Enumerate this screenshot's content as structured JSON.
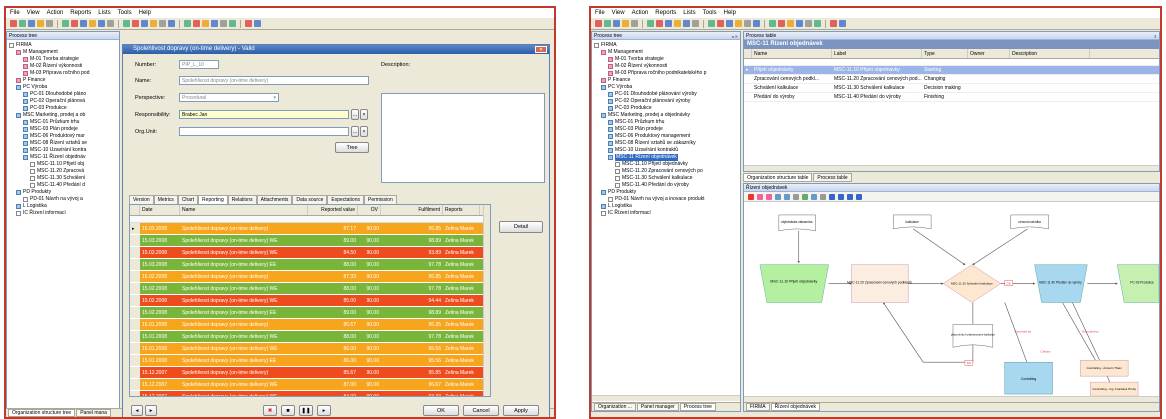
{
  "menu": [
    "File",
    "View",
    "Action",
    "Reports",
    "Lists",
    "Tools",
    "Help"
  ],
  "left": {
    "process_tree_title": "Process tree",
    "tree": [
      {
        "label": "FIRMA",
        "indent": 0,
        "icon": "white"
      },
      {
        "label": "M Management",
        "indent": 1,
        "icon": "pink"
      },
      {
        "label": "M-01 Tvorba strategie",
        "indent": 2,
        "icon": "pink"
      },
      {
        "label": "M-02 Řízení výkonnosti",
        "indent": 2,
        "icon": "pink"
      },
      {
        "label": "M-03 Příprava ročního pod",
        "indent": 2,
        "icon": "pink"
      },
      {
        "label": "P Finance",
        "indent": 1,
        "icon": "pink"
      },
      {
        "label": "PC Výroba",
        "indent": 1,
        "icon": "blue"
      },
      {
        "label": "PC-01 Dlouhodobé pláno",
        "indent": 2,
        "icon": "blue"
      },
      {
        "label": "PC-02 Operační plánová",
        "indent": 2,
        "icon": "blue"
      },
      {
        "label": "PC-03 Produkce",
        "indent": 2,
        "icon": "blue"
      },
      {
        "label": "MSC Marketing, prodej a ob",
        "indent": 1,
        "icon": "blue"
      },
      {
        "label": "MSC-01 Průzkum trhu",
        "indent": 2,
        "icon": "blue"
      },
      {
        "label": "MSC-03 Plán prodeje",
        "indent": 2,
        "icon": "blue"
      },
      {
        "label": "MSC-06 Produktový mar",
        "indent": 2,
        "icon": "blue"
      },
      {
        "label": "MSC-08 Řízení vztahů se",
        "indent": 2,
        "icon": "blue"
      },
      {
        "label": "MSC-10 Uzavírání kontra",
        "indent": 2,
        "icon": "blue"
      },
      {
        "label": "MSC-11 Řízení objednáv",
        "indent": 2,
        "icon": "blue"
      },
      {
        "label": "MSC-11.10 Přijetí obj",
        "indent": 3,
        "icon": "white"
      },
      {
        "label": "MSC-11.20 Zpracová",
        "indent": 3,
        "icon": "white"
      },
      {
        "label": "MSC-11.30 Schválení",
        "indent": 3,
        "icon": "white"
      },
      {
        "label": "MSC-11.40 Předání d",
        "indent": 3,
        "icon": "white"
      },
      {
        "label": "PD Produkty",
        "indent": 1,
        "icon": "blue"
      },
      {
        "label": "PD-01 Návrh na vývoj a",
        "indent": 2,
        "icon": "white"
      },
      {
        "label": "L Logistika",
        "indent": 1,
        "icon": "blue"
      },
      {
        "label": "IC Řízení informací",
        "indent": 1,
        "icon": "white"
      }
    ],
    "bottom_tabs": [
      "Organization structure tree",
      "Panel mana"
    ],
    "dialog": {
      "title": "Spolehlivost dopravy (on-time delivery) - Valid",
      "number_label": "Number:",
      "number_value": "PIP_L_10",
      "name_label": "Name:",
      "name_value": "Spolehlivost dopravy (on-time delivery)",
      "perspective_label": "Perspective:",
      "perspective_value": "Procedural",
      "responsibility_label": "Responsibility:",
      "responsibility_value": "Brabec Jan",
      "orgunit_label": "Org.Unit:",
      "description_label": "Description:",
      "tree_button": "Tree",
      "tabs": [
        "Version",
        "Metrics",
        "Chart",
        "Reporting",
        "Relations",
        "Attachments",
        "Data source",
        "Expectations",
        "Permission"
      ],
      "active_tab": "Reporting",
      "columns": [
        "Date",
        "Name",
        "Reported value",
        "OV",
        "Fulfilment",
        "Reports"
      ],
      "rows": [
        {
          "date": "15.03.2008",
          "name": "Spolehlivost dopravy (on-time delivery)",
          "value": "87.17",
          "ov": "90.00",
          "ful": "96.85",
          "rep": "Zelina Marek",
          "color": "#f7a51c"
        },
        {
          "date": "15.03.2008",
          "name": "Spolehlivost dopravy (on-time delivery) WE",
          "value": "89.00",
          "ov": "90.00",
          "ful": "98.89",
          "rep": "Zelina Marek",
          "color": "#7ab53b"
        },
        {
          "date": "15.03.2008",
          "name": "Spolehlivost dopravy (on-time delivery) WE",
          "value": "84.50",
          "ov": "90.00",
          "ful": "93.89",
          "rep": "Zelina Marek",
          "color": "#ee4b1e"
        },
        {
          "date": "15.03.2008",
          "name": "Spolehlivost dopravy (on-time delivery) EE",
          "value": "88.00",
          "ov": "90.00",
          "ful": "97.78",
          "rep": "Zelina Marek",
          "color": "#7ab53b"
        },
        {
          "date": "15.02.2008",
          "name": "Spolehlivost dopravy (on-time delivery)",
          "value": "87.33",
          "ov": "90.00",
          "ful": "96.85",
          "rep": "Zelina Marek",
          "color": "#f7a51c"
        },
        {
          "date": "15.02.2008",
          "name": "Spolehlivost dopravy (on-time delivery) WE",
          "value": "88.00",
          "ov": "90.00",
          "ful": "97.78",
          "rep": "Zelina Marek",
          "color": "#7ab53b"
        },
        {
          "date": "15.02.2008",
          "name": "Spolehlivost dopravy (on-time delivery) WE",
          "value": "85.00",
          "ov": "90.00",
          "ful": "94.44",
          "rep": "Zelina Marek",
          "color": "#ee4b1e"
        },
        {
          "date": "15.02.2008",
          "name": "Spolehlivost dopravy (on-time delivery) EE",
          "value": "89.00",
          "ov": "90.00",
          "ful": "98.89",
          "rep": "Zelina Marek",
          "color": "#7ab53b"
        },
        {
          "date": "15.01.2008",
          "name": "Spolehlivost dopravy (on-time delivery)",
          "value": "86.67",
          "ov": "90.00",
          "ful": "96.35",
          "rep": "Zelina Marek",
          "color": "#f7a51c"
        },
        {
          "date": "15.01.2008",
          "name": "Spolehlivost dopravy (on-time delivery) WE",
          "value": "88.00",
          "ov": "90.00",
          "ful": "97.78",
          "rep": "Zelina Marek",
          "color": "#7ab53b"
        },
        {
          "date": "15.01.2008",
          "name": "Spolehlivost dopravy (on-time delivery) WE",
          "value": "86.00",
          "ov": "90.00",
          "ful": "95.56",
          "rep": "Zelina Marek",
          "color": "#f7a51c"
        },
        {
          "date": "15.01.2008",
          "name": "Spolehlivost dopravy (on-time delivery) EE",
          "value": "86.00",
          "ov": "90.00",
          "ful": "95.56",
          "rep": "Zelina Marek",
          "color": "#f7a51c"
        },
        {
          "date": "15.12.2007",
          "name": "Spolehlivost dopravy (on-time delivery)",
          "value": "85.67",
          "ov": "90.00",
          "ful": "95.85",
          "rep": "Zelina Marek",
          "color": "#ee4b1e"
        },
        {
          "date": "15.12.2007",
          "name": "Spolehlivost dopravy (on-time delivery) WE",
          "value": "87.00",
          "ov": "90.00",
          "ful": "96.67",
          "rep": "Zelina Marek",
          "color": "#f7a51c"
        },
        {
          "date": "15.12.2007",
          "name": "Spolehlivost dopravy (on-time delivery) WE",
          "value": "84.00",
          "ov": "90.00",
          "ful": "93.33",
          "rep": "Zelina Marek",
          "color": "#ee4b1e"
        }
      ],
      "detail_button": "Detail",
      "ok_button": "OK",
      "cancel_button": "Cancel",
      "apply_button": "Apply"
    }
  },
  "right": {
    "process_tree_title": "Process tree",
    "tree": [
      {
        "label": "FIRMA",
        "indent": 0,
        "icon": "white"
      },
      {
        "label": "M Management",
        "indent": 1,
        "icon": "pink"
      },
      {
        "label": "M-01 Tvorba strategie",
        "indent": 2,
        "icon": "pink"
      },
      {
        "label": "M-02 Řízení výkonnosti",
        "indent": 2,
        "icon": "pink"
      },
      {
        "label": "M-03 Příprava ročního podnikatelského p",
        "indent": 2,
        "icon": "pink"
      },
      {
        "label": "P Finance",
        "indent": 1,
        "icon": "pink"
      },
      {
        "label": "PC Výroba",
        "indent": 1,
        "icon": "blue"
      },
      {
        "label": "PC-01 Dlouhodobé plánování výroby",
        "indent": 2,
        "icon": "blue"
      },
      {
        "label": "PC-02 Operační plánování výroby",
        "indent": 2,
        "icon": "blue"
      },
      {
        "label": "PC-03 Produkce",
        "indent": 2,
        "icon": "blue"
      },
      {
        "label": "MSC Marketing, prodej a objednávky",
        "indent": 1,
        "icon": "blue"
      },
      {
        "label": "MSC-01 Průzkum trhu",
        "indent": 2,
        "icon": "blue"
      },
      {
        "label": "MSC-03 Plán prodeje",
        "indent": 2,
        "icon": "blue"
      },
      {
        "label": "MSC-06 Produktový management",
        "indent": 2,
        "icon": "blue"
      },
      {
        "label": "MSC-08 Řízení vztahů se zákazníky",
        "indent": 2,
        "icon": "blue"
      },
      {
        "label": "MSC-10 Uzavírání kontraktů",
        "indent": 2,
        "icon": "blue"
      },
      {
        "label": "MSC-11 Řízení objednávek",
        "indent": 2,
        "icon": "blue",
        "selected": true
      },
      {
        "label": "MSC-11.10 Přijetí objednávky",
        "indent": 3,
        "icon": "white"
      },
      {
        "label": "MSC-11.20 Zpracování cenových po",
        "indent": 3,
        "icon": "white"
      },
      {
        "label": "MSC-11.30 Schválení kalkulace",
        "indent": 3,
        "icon": "white"
      },
      {
        "label": "MSC-11.40 Předání do výroby",
        "indent": 3,
        "icon": "white"
      },
      {
        "label": "PD Produkty",
        "indent": 1,
        "icon": "blue"
      },
      {
        "label": "PD-01 Návrh na vývoj a inovace produkt",
        "indent": 2,
        "icon": "white"
      },
      {
        "label": "L Logistika",
        "indent": 1,
        "icon": "blue"
      },
      {
        "label": "IC Řízení informací",
        "indent": 1,
        "icon": "white"
      }
    ],
    "left_bottom_tabs": [
      "Organization ...",
      "Panel manager",
      "Process tree"
    ],
    "process_table_title": "Process table",
    "process_table_header": "MSC-11 Řízení objednávek",
    "table_columns": [
      "Name",
      "Label",
      "Type",
      "Owner",
      "Description"
    ],
    "table_rows": [
      {
        "name": "Přijetí objednávky",
        "label": "MSC-11.10 Přijetí objednávky",
        "type": "Starting",
        "owner": "",
        "desc": "",
        "selected": true
      },
      {
        "name": "Zpracování cenových podkl...",
        "label": "MSC-11.20 Zpracování cenových pod...",
        "type": "Changing",
        "owner": "",
        "desc": ""
      },
      {
        "name": "Schválení kalkulace",
        "label": "MSC-11.30 Schválení kalkulace",
        "type": "Decision making",
        "owner": "",
        "desc": ""
      },
      {
        "name": "Předání do výroby",
        "label": "MSC-11.40 Předání do výroby",
        "type": "Finishing",
        "owner": "",
        "desc": ""
      }
    ],
    "mid_tabs": [
      "Organization structure table",
      "Process table"
    ],
    "diagram_title": "Řízení objednávek",
    "diagram": {
      "nodes": {
        "objednavka_zakaznika": "objednávka zákazníka",
        "kalkulace": "kalkulace",
        "cenova_nabidka": "cenová nabídka",
        "n1": "MSC-11.10 Přijetí objednávky",
        "n2": "MSC-11.20 Zpracování cenových podkladů",
        "n3": "MSC-11.30 Schválení kalkulace",
        "n4": "MSC-11.40 Předání do výroby",
        "n5": "PC-03 Produkce",
        "pripominky": "připomínky k připravované kalkulaci",
        "executed1": "Executed by",
        "executed2": "Executed by",
        "checks": "Checks",
        "controlling": "Controlling",
        "controlling_a": "Controlling - Antonín Tham",
        "controlling_b": "Controlling - Ing. František Hrubý",
        "ok_label": "OK",
        "ko_label": "KO"
      }
    },
    "bottom_tabs": [
      "FIRMA",
      "Řízení objednávek"
    ]
  }
}
